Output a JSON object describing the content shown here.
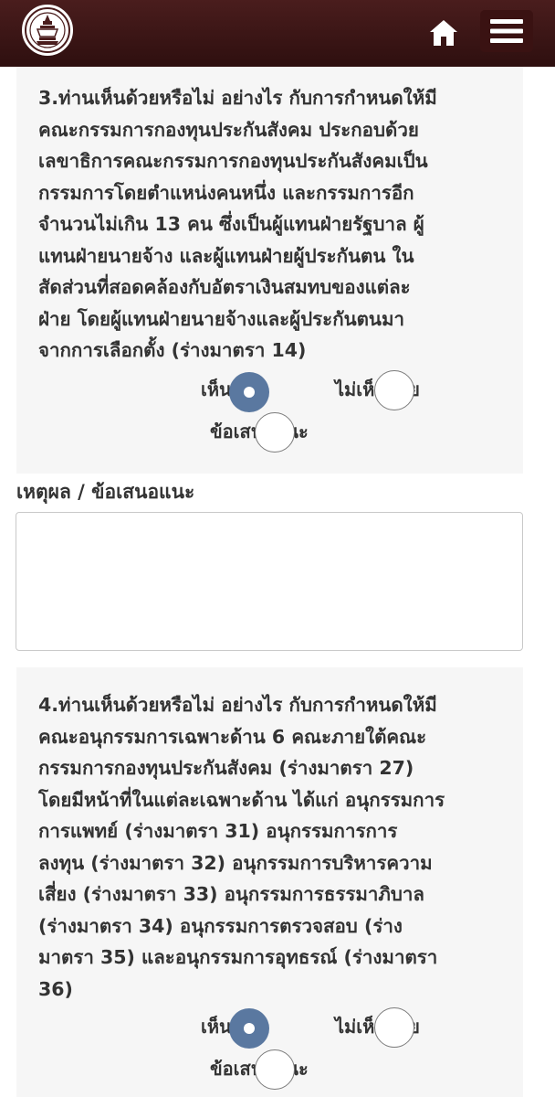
{
  "header": {
    "logo_icon": "parliament-emblem-icon",
    "home_icon": "home-icon",
    "menu_icon": "hamburger-menu-icon"
  },
  "q3": {
    "text": "3.ท่านเห็นด้วยหรือไม่ อย่างไร กับการกำหนดให้มี\nคณะกรรมการกองทุนประกันสังคม ประกอบด้วย\nเลขาธิการคณะกรรมการกองทุนประกันสังคมเป็น\nกรรมการโดยตำแหน่งคนหนึ่ง และกรรมการอีก\nจำนวนไม่เกิน 13 คน ซึ่งเป็นผู้แทนฝ่ายรัฐบาล ผู้\nแทนฝ่ายนายจ้าง และผู้แทนฝ่ายผู้ประกันตน ใน\nสัดส่วนที่สอดคล้องกับอัตราเงินสมทบของแต่ละ\nฝ่าย โดยผู้แทนฝ่ายนายจ้างและผู้ประกันตนมา\nจากการเลือกตั้ง (ร่างมาตรา 14)",
    "options": [
      {
        "label": "เห็นด้วย",
        "checked": true
      },
      {
        "label": "ไม่เห็นด้วย",
        "checked": false
      },
      {
        "label": "ข้อเสนอแนะ",
        "checked": false
      }
    ]
  },
  "reason": {
    "label": "เหตุผล / ข้อเสนอแนะ",
    "value": ""
  },
  "q4": {
    "text": "4.ท่านเห็นด้วยหรือไม่ อย่างไร กับการกำหนดให้มี\nคณะอนุกรรมการเฉพาะด้าน 6 คณะภายใต้คณะ\nกรรมการกองทุนประกันสังคม (ร่างมาตรา 27)\nโดยมีหน้าที่ในแต่ละเฉพาะด้าน ได้แก่ อนุกรรมการ\nการแพทย์ (ร่างมาตรา 31) อนุกรรมการการ\nลงทุน (ร่างมาตรา 32) อนุกรรมการบริหารความ\nเสี่ยง (ร่างมาตรา 33) อนุกรรมการธรรมาภิบาล\n(ร่างมาตรา 34) อนุกรรมการตรวจสอบ (ร่าง\nมาตรา 35) และอนุกรรมการอุทธรณ์ (ร่างมาตรา\n36)",
    "options": [
      {
        "label": "เห็นด้วย",
        "checked": true
      },
      {
        "label": "ไม่เห็นด้วย",
        "checked": false
      },
      {
        "label": "ข้อเสนอแนะ",
        "checked": false
      }
    ]
  },
  "colors": {
    "header": "#3a1414",
    "radio_checked": "#5a78a0",
    "card_bg": "#f6f6f6"
  }
}
